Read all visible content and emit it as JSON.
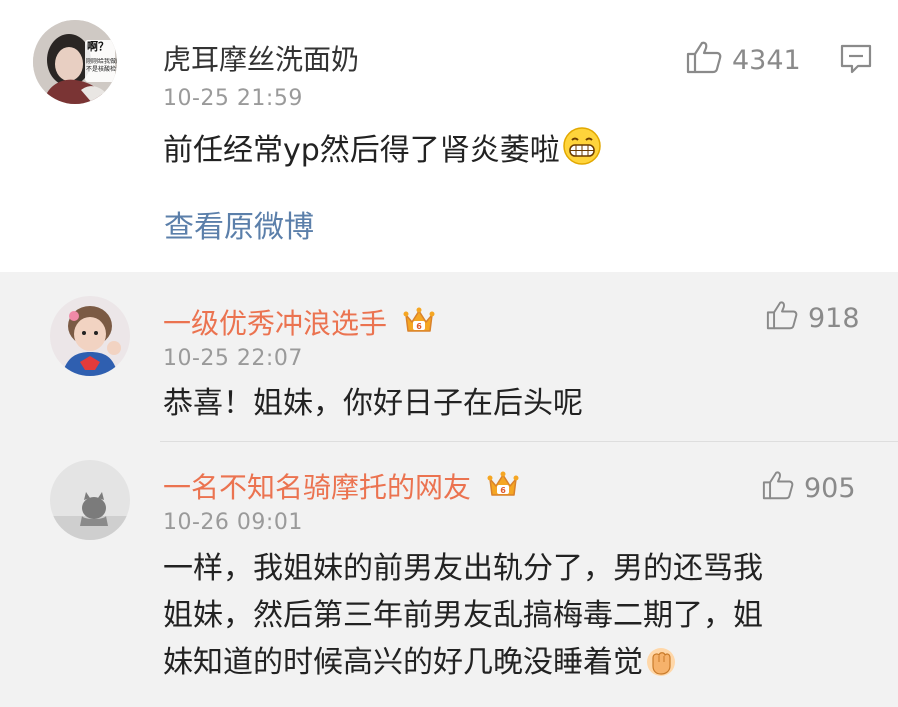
{
  "main_comment": {
    "username": "虎耳摩丝洗面奶",
    "time": "10-25 21:59",
    "content": "前任经常yp然后得了肾炎萎啦",
    "emoji": "grin-emoji",
    "likes": "4341",
    "view_original": "查看原微博",
    "avatar_text": "啊？",
    "avatar_subtext": [
      "刚刚给我做的",
      "不是核酸检测"
    ]
  },
  "replies": [
    {
      "username": "一级优秀冲浪选手",
      "time": "10-25 22:07",
      "content": "恭喜！姐妹，你好日子在后头呢",
      "likes": "918",
      "badge": "crown-badge-icon"
    },
    {
      "username": "一名不知名骑摩托的网友",
      "time": "10-26 09:01",
      "content_lines": [
        "一样，我姐妹的前男友出轨分了，男的还骂我",
        "姐妹，然后第三年前男友乱搞梅毒二期了，姐",
        "妹知道的时候高兴的好几晚没睡着觉"
      ],
      "likes": "905",
      "badge": "crown-badge-icon",
      "emoji": "fist-emoji"
    }
  ],
  "colors": {
    "vip_name": "#eb7350",
    "link": "#5b7faa",
    "meta": "#9a9a9a",
    "background": "#f2f2f2"
  }
}
